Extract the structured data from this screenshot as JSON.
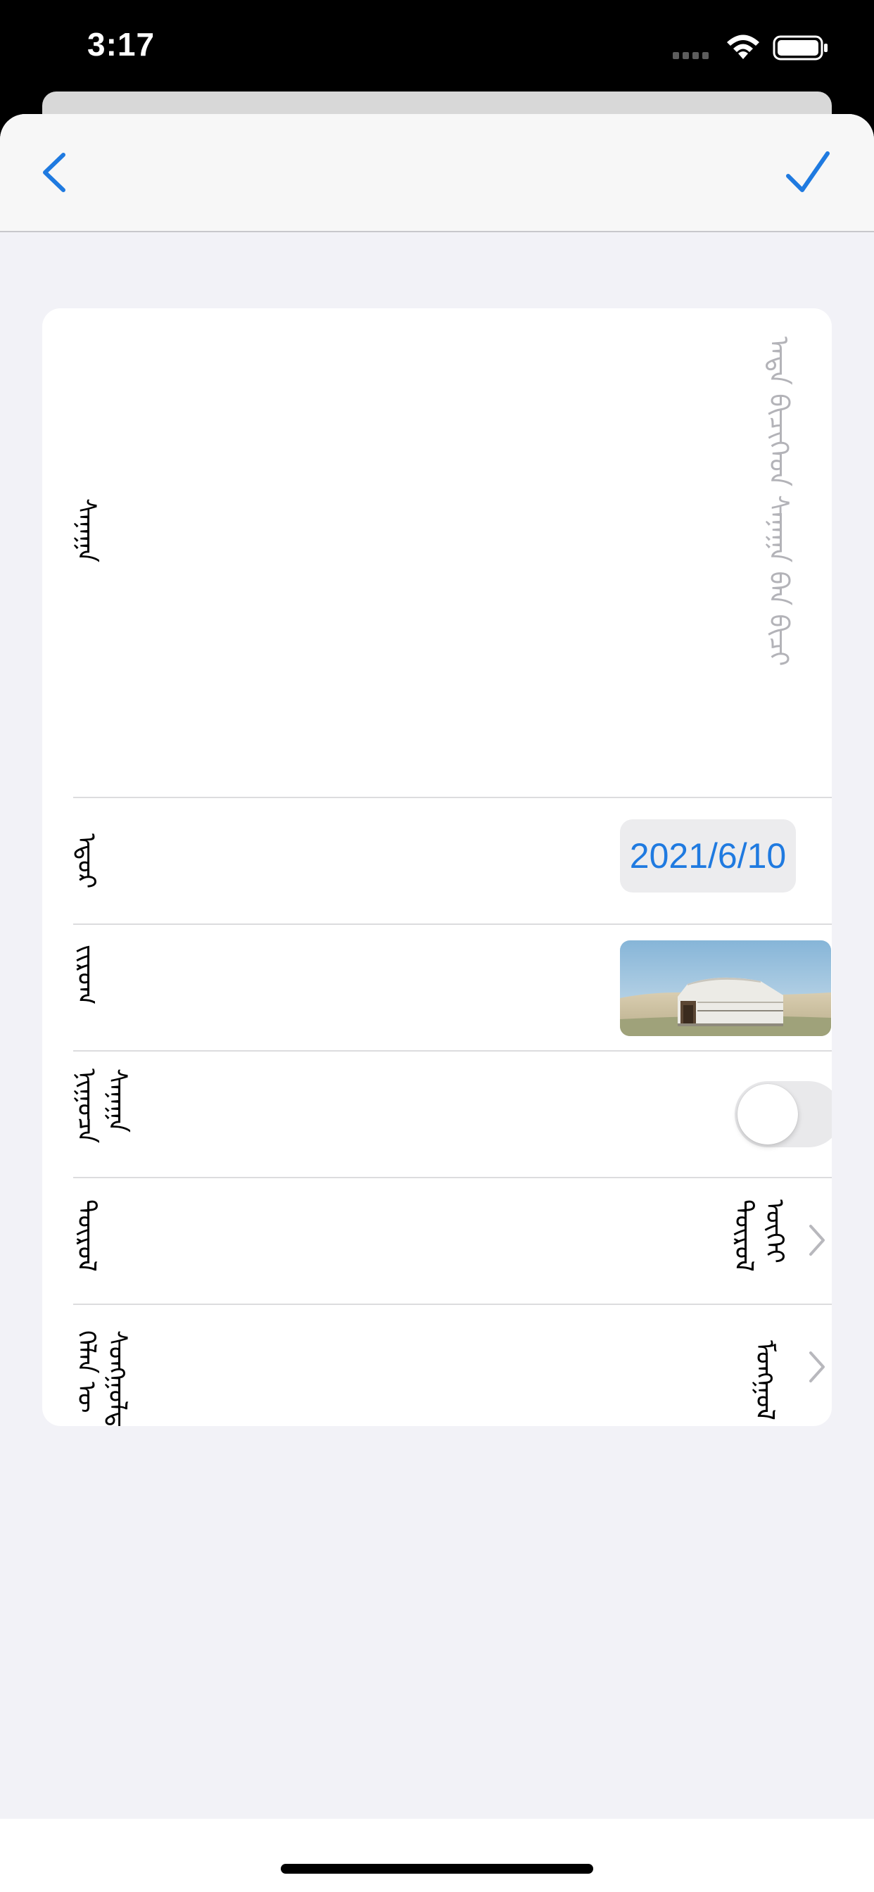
{
  "status_bar": {
    "time": "3:17"
  },
  "nav": {
    "back_icon": "chevron-left-icon",
    "done_icon": "checkmark-icon",
    "accent_color": "#1f7ae0"
  },
  "form": {
    "text_field": {
      "label": "ᠰᠠᠨᠠᠭᠠ",
      "placeholder": "ᠡᠨᠳᠡ ᠪᠢᠴᠢᠭᠡᠳ ᠰᠠᠨᠠᠭᠠ ᠪᠠᠨ ᠪᠢᠴᠢ"
    },
    "date_row": {
      "label": "ᠡᠳᠦᠷ",
      "value": "2021/6/10"
    },
    "photo_row": {
      "label": "ᠵᠢᠷᠤᠭ",
      "image": "yurt-photo"
    },
    "toggle_row": {
      "label": "ᠨᠢᠭᠤᠴᠠ ᠰᠠᠨᠠᠭᠠ",
      "enabled": false
    },
    "category_row": {
      "label": "ᠲᠥᠷᠥᠯ",
      "value": "ᠲᠥᠷᠥᠯ ᠦᠭᠡᠢ"
    },
    "language_row": {
      "label": "ᠬᠡᠯᠡᠨ ᠦ ᠰᠣᠩᠭᠣᠯᠲᠠ",
      "value": "ᠮᠣᠩᠭᠣᠯ"
    }
  }
}
